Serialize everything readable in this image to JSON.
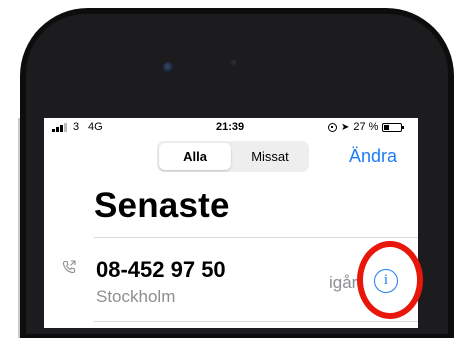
{
  "status_bar": {
    "carrier": "3",
    "network": "4G",
    "time": "21:39",
    "battery": "27 %"
  },
  "segmented_control": {
    "options": [
      "Alla",
      "Missat"
    ],
    "selected": "Alla"
  },
  "header": {
    "edit_label": "Ändra",
    "title": "Senaste"
  },
  "calls": [
    {
      "number": "08-452 97 50",
      "location": "Stockholm",
      "time": "igår",
      "icon": "phone-outgoing-icon"
    }
  ],
  "colors": {
    "accent": "#1e7cf5",
    "annotation": "#e8170b"
  }
}
